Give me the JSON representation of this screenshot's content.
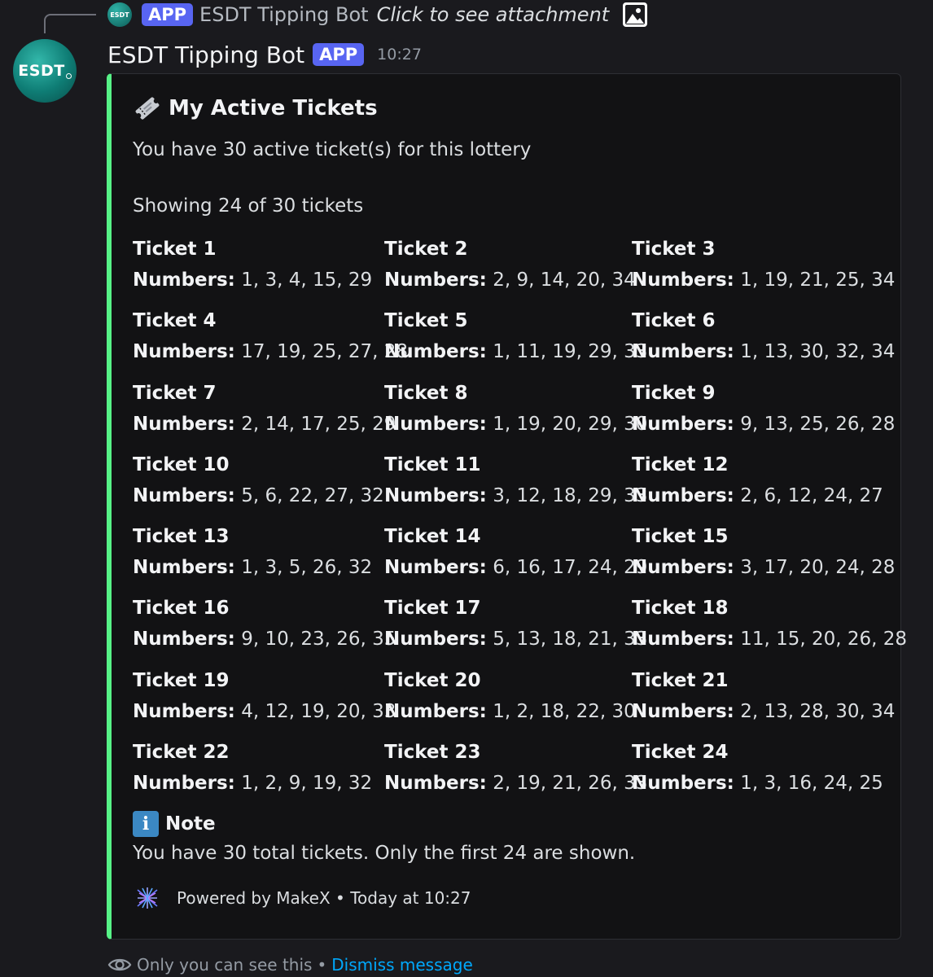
{
  "reply": {
    "avatar_text": "ESDT",
    "app_tag": "APP",
    "author": "ESDT Tipping Bot",
    "link_text": "Click to see attachment",
    "attachment_icon": "image-icon"
  },
  "message": {
    "avatar_text": "ESDT",
    "author": "ESDT Tipping Bot",
    "app_tag": "APP",
    "timestamp": "10:27"
  },
  "embed": {
    "accent_color": "#57f287",
    "title_icon": "ticket-icon",
    "title": "My Active Tickets",
    "description": "You have 30 active ticket(s) for this lottery",
    "showing": "Showing 24 of 30 tickets",
    "numbers_label": "Numbers:",
    "tickets": [
      {
        "name": "Ticket 1",
        "numbers": "1, 3, 4, 15, 29"
      },
      {
        "name": "Ticket 2",
        "numbers": "2, 9, 14, 20, 34"
      },
      {
        "name": "Ticket 3",
        "numbers": "1, 19, 21, 25, 34"
      },
      {
        "name": "Ticket 4",
        "numbers": "17, 19, 25, 27, 28"
      },
      {
        "name": "Ticket 5",
        "numbers": "1, 11, 19, 29, 33"
      },
      {
        "name": "Ticket 6",
        "numbers": "1, 13, 30, 32, 34"
      },
      {
        "name": "Ticket 7",
        "numbers": "2, 14, 17, 25, 29"
      },
      {
        "name": "Ticket 8",
        "numbers": "1, 19, 20, 29, 30"
      },
      {
        "name": "Ticket 9",
        "numbers": "9, 13, 25, 26, 28"
      },
      {
        "name": "Ticket 10",
        "numbers": "5, 6, 22, 27, 32"
      },
      {
        "name": "Ticket 11",
        "numbers": "3, 12, 18, 29, 33"
      },
      {
        "name": "Ticket 12",
        "numbers": "2, 6, 12, 24, 27"
      },
      {
        "name": "Ticket 13",
        "numbers": "1, 3, 5, 26, 32"
      },
      {
        "name": "Ticket 14",
        "numbers": "6, 16, 17, 24, 29"
      },
      {
        "name": "Ticket 15",
        "numbers": "3, 17, 20, 24, 28"
      },
      {
        "name": "Ticket 16",
        "numbers": "9, 10, 23, 26, 35"
      },
      {
        "name": "Ticket 17",
        "numbers": "5, 13, 18, 21, 33"
      },
      {
        "name": "Ticket 18",
        "numbers": "11, 15, 20, 26, 28"
      },
      {
        "name": "Ticket 19",
        "numbers": "4, 12, 19, 20, 33"
      },
      {
        "name": "Ticket 20",
        "numbers": "1, 2, 18, 22, 30"
      },
      {
        "name": "Ticket 21",
        "numbers": "2, 13, 28, 30, 34"
      },
      {
        "name": "Ticket 22",
        "numbers": "1, 2, 9, 19, 32"
      },
      {
        "name": "Ticket 23",
        "numbers": "2, 19, 21, 26, 33"
      },
      {
        "name": "Ticket 24",
        "numbers": "1, 3, 16, 24, 25"
      }
    ],
    "note_icon": "info-icon",
    "note_icon_glyph": "i",
    "note_title": "Note",
    "note_text": "You have 30 total tickets. Only the first 24 are shown.",
    "footer_icon": "makex-logo-icon",
    "footer_text": "Powered by MakeX",
    "footer_separator": "•",
    "footer_time": "Today at 10:27"
  },
  "ephemeral": {
    "icon": "eye-icon",
    "text": "Only you can see this",
    "separator": "•",
    "dismiss_label": "Dismiss message"
  }
}
